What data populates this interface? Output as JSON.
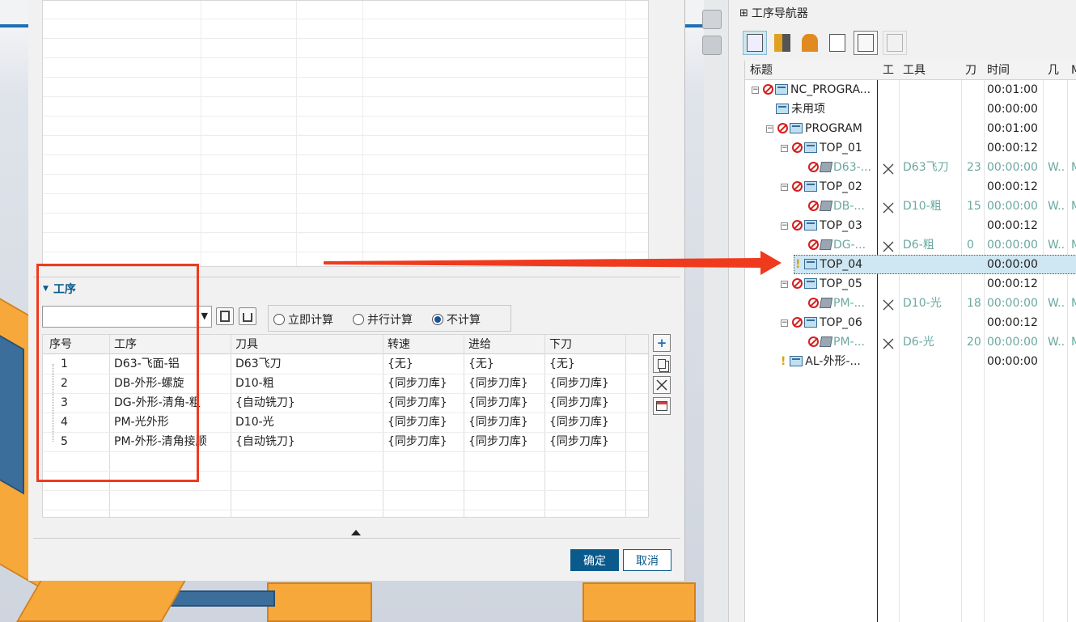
{
  "dialog": {
    "section_title": "工序",
    "radios": [
      {
        "label": "立即计算",
        "checked": false
      },
      {
        "label": "并行计算",
        "checked": false
      },
      {
        "label": "不计算",
        "checked": true
      }
    ],
    "table": {
      "headers": [
        "序号",
        "工序",
        "刀具",
        "转速",
        "进给",
        "下刀"
      ],
      "rows": [
        [
          "1",
          "D63-飞面-铝",
          "D63飞刀",
          "{无}",
          "{无}",
          "{无}"
        ],
        [
          "2",
          "DB-外形-螺旋",
          "D10-粗",
          "{同步刀库}",
          "{同步刀库}",
          "{同步刀库}"
        ],
        [
          "3",
          "DG-外形-清角-粗",
          "{自动铣刀}",
          "{同步刀库}",
          "{同步刀库}",
          "{同步刀库}"
        ],
        [
          "4",
          "PM-光外形",
          "D10-光",
          "{同步刀库}",
          "{同步刀库}",
          "{同步刀库}"
        ],
        [
          "5",
          "PM-外形-清角接顺",
          "{自动铣刀}",
          "{同步刀库}",
          "{同步刀库}",
          "{同步刀库}"
        ]
      ]
    },
    "side_buttons": [
      "+"
    ],
    "ok_label": "确定",
    "cancel_label": "取消"
  },
  "navigator": {
    "title": "工序导航器",
    "columns": [
      "标题",
      "工",
      "工具",
      "刀",
      "时间",
      "几",
      "M"
    ],
    "rows": [
      {
        "title": "NC_PROGRA...",
        "time": "00:01:00"
      },
      {
        "title": "未用项",
        "time": "00:00:00"
      },
      {
        "title": "PROGRAM",
        "time": "00:01:00"
      },
      {
        "title": "TOP_01",
        "time": "00:00:12"
      },
      {
        "title": "D63-...",
        "tool": "D63飞刀",
        "num": "23",
        "time": "00:00:00",
        "geo": "W..",
        "m": "M"
      },
      {
        "title": "TOP_02",
        "time": "00:00:12"
      },
      {
        "title": "DB-...",
        "tool": "D10-粗",
        "num": "15",
        "time": "00:00:00",
        "geo": "W..",
        "m": "M"
      },
      {
        "title": "TOP_03",
        "time": "00:00:12"
      },
      {
        "title": "DG-...",
        "tool": "D6-粗",
        "num": "0",
        "time": "00:00:00",
        "geo": "W..",
        "m": "M"
      },
      {
        "title": "TOP_04",
        "time": "00:00:00"
      },
      {
        "title": "TOP_05",
        "time": "00:00:12"
      },
      {
        "title": "PM-...",
        "tool": "D10-光",
        "num": "18",
        "time": "00:00:00",
        "geo": "W..",
        "m": "M"
      },
      {
        "title": "TOP_06",
        "time": "00:00:12"
      },
      {
        "title": "PM-...",
        "tool": "D6-光",
        "num": "20",
        "time": "00:00:00",
        "geo": "W..",
        "m": "M"
      },
      {
        "title": "AL-外形-...",
        "time": "00:00:00"
      }
    ]
  },
  "colors": {
    "accent": "#0b5a8c",
    "annotation": "#f03a1e",
    "selected_row": "#cfe7f2"
  }
}
